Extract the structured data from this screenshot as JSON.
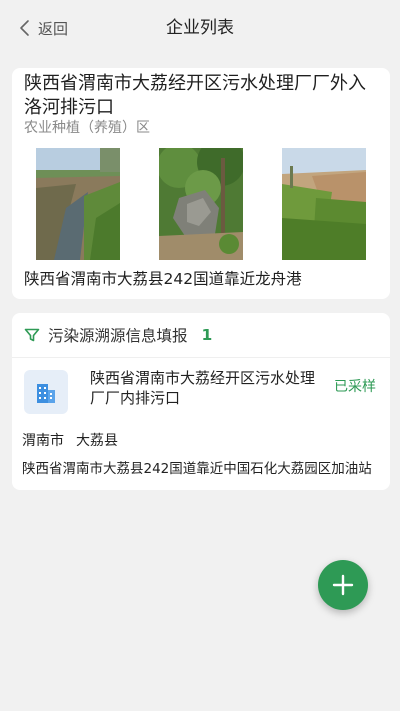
{
  "header": {
    "back_label": "返回",
    "title": "企业列表"
  },
  "outlet_card": {
    "title": "陕西省渭南市大荔经开区污水处理厂厂外入洛河排污口",
    "category": "农业种植（养殖）区",
    "photos": [
      "photo-1",
      "photo-2",
      "photo-3"
    ],
    "address": "陕西省渭南市大荔县242国道靠近龙舟港"
  },
  "trace_section": {
    "label": "污染源溯源信息填报",
    "count": "1",
    "icon": "filter-icon",
    "accent_color": "#2e9a55"
  },
  "enterprise": {
    "icon": "building-icon",
    "name": "陕西省渭南市大荔经开区污水处理厂厂内排污口",
    "status": "已采样",
    "city": "渭南市",
    "county": "大荔县",
    "address": "陕西省渭南市大荔县242国道靠近中国石化大荔园区加油站"
  },
  "fab": {
    "icon": "plus-icon",
    "color": "#2e9a55"
  }
}
